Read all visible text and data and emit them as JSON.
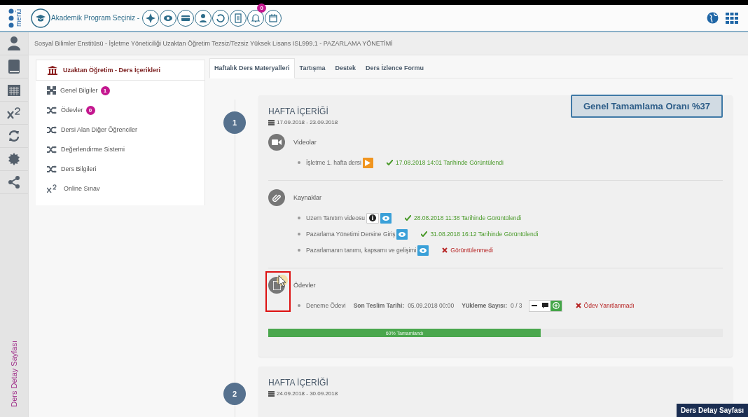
{
  "logo": {
    "label": "menü"
  },
  "toolbar": {
    "program_label": "Akademik Program Seçiniz -",
    "notification_count": "0"
  },
  "breadcrumb": "Sosyal Bilimler Enstitüsü - İşletme Yöneticiliği Uzaktan Öğretim Tezsiz/Tezsiz Yüksek Lisans ISL999.1 - PAZARLAMA YÖNETİMİ",
  "rail": {
    "label": "Ders Detay Sayfası"
  },
  "side_menu": {
    "header": "Uzaktan Öğretim - Ders İçerikleri",
    "items": [
      {
        "kind": "cube",
        "label": "Genel Bilgiler",
        "badge": "1"
      },
      {
        "kind": "shuffle",
        "label": "Ödevler",
        "badge": "0"
      },
      {
        "kind": "shuffle",
        "label": "Dersi Alan Diğer Öğrenciler"
      },
      {
        "kind": "shuffle",
        "label": "Değerlendirme Sistemi"
      },
      {
        "kind": "shuffle",
        "label": "Ders Bilgileri"
      },
      {
        "kind": "superscript",
        "label": "Online Sınav"
      }
    ]
  },
  "tabs": [
    {
      "label": "Haftalık Ders Materyalleri",
      "selected": true
    },
    {
      "label": "Tartışma",
      "selected": false
    },
    {
      "label": "Destek",
      "selected": false
    },
    {
      "label": "Ders İzlence Formu",
      "selected": false
    }
  ],
  "completion": "Genel Tamamlama Oranı %37",
  "weeks": [
    {
      "number": "1",
      "title": "HAFTA İÇERİĞİ",
      "dates": "17.09.2018 - 23.09.2018",
      "sections": [
        {
          "kind": "video",
          "title": "Videolar",
          "items": [
            {
              "kind": "resource",
              "name": "İşletme 1. hafta dersi",
              "buttons": [
                {
                  "kind": "play"
                }
              ],
              "viewed": true,
              "status": "17.08.2018 14:01 Tarihinde Görüntülendi"
            }
          ]
        },
        {
          "kind": "resource",
          "title": "Kaynaklar",
          "items": [
            {
              "kind": "resource",
              "name": "Uzem Tanıtım videosu",
              "buttons": [
                {
                  "kind": "info"
                },
                {
                  "kind": "eye"
                }
              ],
              "viewed": true,
              "status": "28.08.2018 11:38 Tarihinde Görüntülendi"
            },
            {
              "kind": "resource",
              "name": "Pazarlama Yönetimi Dersine Giriş",
              "buttons": [
                {
                  "kind": "eye"
                }
              ],
              "viewed": true,
              "status": "31.08.2018 16:12 Tarihinde Görüntülendi"
            },
            {
              "kind": "resource",
              "name": "Pazarlamanın tanımı, kapsamı ve gelişimi",
              "buttons": [
                {
                  "kind": "eye"
                }
              ],
              "viewed": false,
              "status": "Görüntülenmedi"
            }
          ]
        },
        {
          "kind": "assignment",
          "title": "Ödevler",
          "items": [
            {
              "kind": "assignment",
              "name": "Deneme Ödevi",
              "deadline_label": "Son Teslim Tarihi:",
              "deadline": "05.09.2018 00:00",
              "uploads_label": "Yükleme Sayısı:",
              "uploads": "0 / 3",
              "buttons": [
                {
                  "kind": "minus"
                },
                {
                  "kind": "comment"
                },
                {
                  "kind": "plus"
                }
              ],
              "viewed": false,
              "status": "Ödev Yanıtlanmadı"
            }
          ]
        }
      ],
      "progress": {
        "level": 0.6,
        "label": "60% Tamamlandı"
      }
    },
    {
      "number": "2",
      "title": "HAFTA İÇERİĞİ",
      "dates": "24.09.2018 - 30.09.2018"
    }
  ],
  "footer_tag": "Ders Detay Sayfası"
}
